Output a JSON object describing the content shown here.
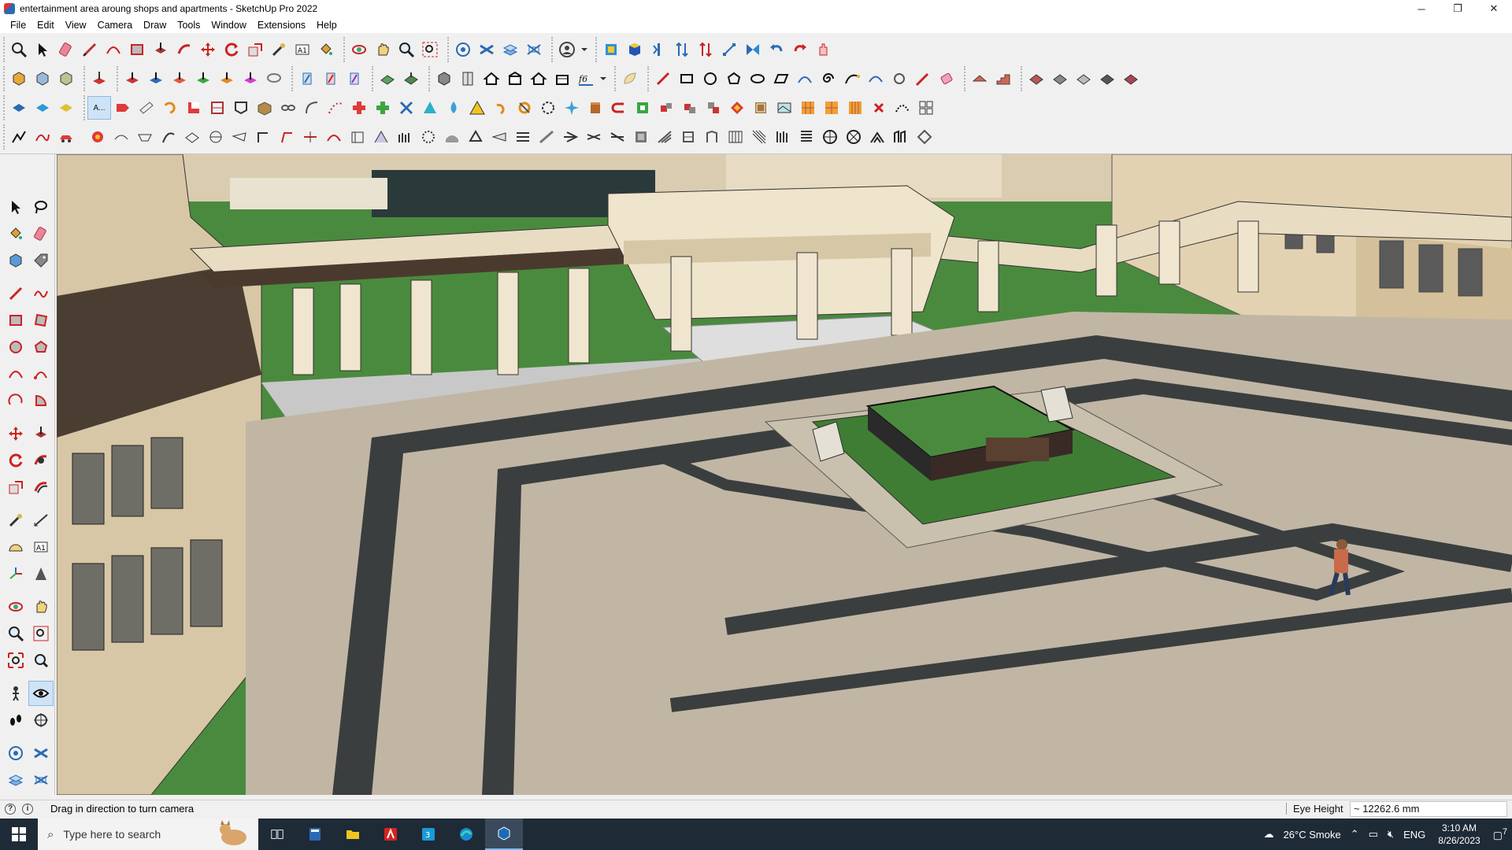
{
  "window": {
    "title": "entertainment area aroung shops and apartments - SketchUp Pro 2022",
    "controls": {
      "minimize": "─",
      "restore": "❐",
      "close": "✕"
    }
  },
  "menu": [
    "File",
    "Edit",
    "View",
    "Camera",
    "Draw",
    "Tools",
    "Window",
    "Extensions",
    "Help"
  ],
  "toolbar": {
    "tag_popup_label": "A..."
  },
  "status": {
    "hint": "Drag in direction to turn camera",
    "measure_label": "Eye Height",
    "measure_value": "~ 12262.6 mm"
  },
  "taskbar": {
    "search_placeholder": "Type here to search",
    "weather": "26°C  Smoke",
    "language": "ENG",
    "time": "3:10 AM",
    "date": "8/26/2023",
    "notifications": "7"
  }
}
